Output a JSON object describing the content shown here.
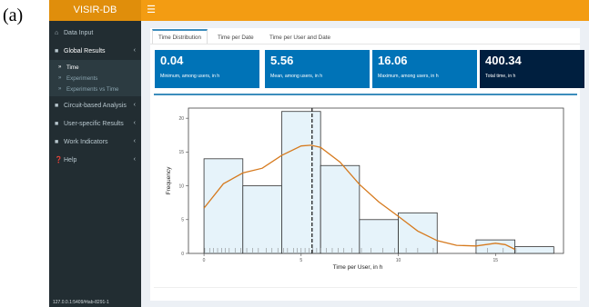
{
  "figure_label": "(a)",
  "app": {
    "title": "VISIR-DB",
    "hamburger_icon": "menu-icon"
  },
  "sidebar": {
    "items": [
      {
        "label": "Data Input",
        "icon": "home-icon",
        "chevron": false
      },
      {
        "label": "Global Results",
        "icon": "folder-icon",
        "chevron": true,
        "children": [
          {
            "label": "Time",
            "active": true
          },
          {
            "label": "Experiments",
            "active": false
          },
          {
            "label": "Experiments vs Time",
            "active": false
          }
        ]
      },
      {
        "label": "Circuit-based Analysis",
        "icon": "folder-icon",
        "chevron": true
      },
      {
        "label": "User-specific Results",
        "icon": "folder-icon",
        "chevron": true
      },
      {
        "label": "Work Indicators",
        "icon": "folder-icon",
        "chevron": true
      },
      {
        "label": "Help",
        "icon": "question-icon",
        "chevron": true
      }
    ],
    "status_url": "127.0.0.1:5409/#tab-8291-1"
  },
  "tabs": [
    {
      "label": "Time Distribution",
      "active": true
    },
    {
      "label": "Time per Date",
      "active": false
    },
    {
      "label": "Time per User and Date",
      "active": false
    }
  ],
  "value_boxes": [
    {
      "value": "0.04",
      "label": "Minimum, among users, in h",
      "color": "#0073b7"
    },
    {
      "value": "5.56",
      "label": "Mean, among users, in h",
      "color": "#0073b7"
    },
    {
      "value": "16.06",
      "label": "Maximum, among users, in h",
      "color": "#0073b7"
    },
    {
      "value": "400.34",
      "label": "Total time, in h",
      "color": "#001f3f"
    }
  ],
  "chart_data": {
    "type": "histogram",
    "xlabel": "Time per User, in h",
    "ylabel": "Frequency",
    "xlim": [
      -0.8,
      18.5
    ],
    "ylim": [
      0,
      21.5
    ],
    "xticks": [
      0,
      5,
      10,
      15
    ],
    "yticks": [
      0,
      5,
      10,
      15,
      20
    ],
    "bins": [
      {
        "x0": 0,
        "x1": 2,
        "count": 14
      },
      {
        "x0": 2,
        "x1": 4,
        "count": 10
      },
      {
        "x0": 4,
        "x1": 6,
        "count": 21
      },
      {
        "x0": 6,
        "x1": 8,
        "count": 13
      },
      {
        "x0": 8,
        "x1": 10,
        "count": 5
      },
      {
        "x0": 10,
        "x1": 12,
        "count": 6
      },
      {
        "x0": 12,
        "x1": 14,
        "count": 0
      },
      {
        "x0": 14,
        "x1": 16,
        "count": 2
      },
      {
        "x0": 16,
        "x1": 18,
        "count": 1
      }
    ],
    "density_curve": {
      "x": [
        0,
        1,
        2,
        3,
        4,
        5,
        5.5,
        6,
        7,
        8,
        9,
        10,
        11,
        12,
        13,
        14,
        15,
        15.5,
        16
      ],
      "y": [
        6.7,
        10.3,
        11.9,
        12.6,
        14.5,
        15.9,
        16.0,
        15.7,
        13.5,
        10.2,
        7.6,
        5.5,
        3.3,
        1.9,
        1.2,
        1.1,
        1.5,
        1.3,
        0.6
      ]
    },
    "mean_line": 5.56,
    "rug": [
      0.04,
      0.3,
      0.5,
      0.7,
      0.9,
      1.1,
      1.3,
      1.6,
      1.9,
      2.2,
      2.5,
      2.8,
      3.2,
      3.5,
      3.8,
      4.1,
      4.3,
      4.6,
      4.8,
      5.0,
      5.2,
      5.4,
      5.6,
      5.8,
      6.0,
      6.3,
      6.6,
      6.9,
      7.2,
      7.6,
      8.1,
      8.6,
      9.2,
      9.8,
      10.4,
      11.0,
      11.8,
      14.6,
      15.4,
      16.06
    ],
    "colors": {
      "bar_fill": "#e6f3fa",
      "bar_stroke": "#333333",
      "curve": "#d67a1e",
      "mean": "#222222",
      "panel_border": "#444444"
    }
  }
}
